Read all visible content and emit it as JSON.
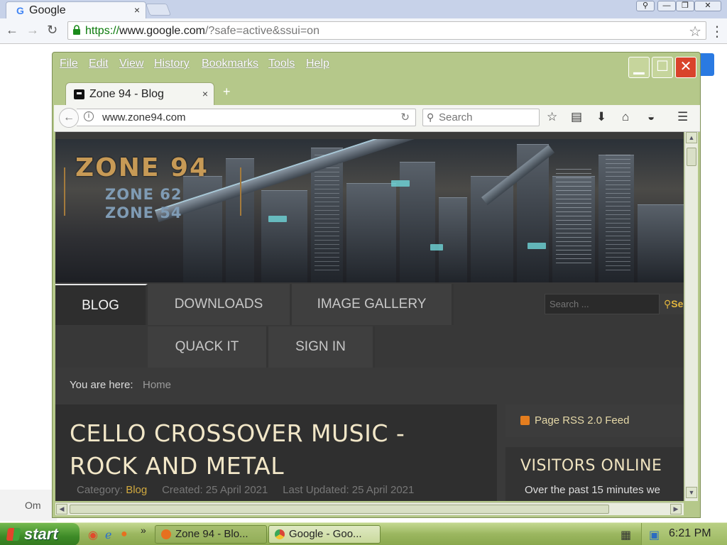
{
  "chrome": {
    "tab_title": "Google",
    "tab_close": "×",
    "url_scheme": "https://",
    "url_host": "www.google.com",
    "url_path": "/?safe=active&ssui=on",
    "window_buttons": [
      "⚲",
      "—",
      "❐",
      "✕"
    ]
  },
  "google_page": {
    "footer_fragment": "Om"
  },
  "firefox": {
    "menu": [
      "File",
      "Edit",
      "View",
      "History",
      "Bookmarks",
      "Tools",
      "Help"
    ],
    "tab_title": "Zone 94 - Blog",
    "tab_close": "×",
    "new_tab": "+",
    "url": "www.zone94.com",
    "search_placeholder": "Search"
  },
  "site": {
    "logo_main": "ZONE 94",
    "logo_sub1": "ZONE 62",
    "logo_sub2": "ZONE 54",
    "nav": {
      "blog": "BLOG",
      "downloads": "DOWNLOADS",
      "gallery": "IMAGE GALLERY",
      "quack": "QUACK IT",
      "signin": "SIGN IN"
    },
    "search_placeholder": "Search ...",
    "search_button": "Se",
    "breadcrumb_label": "You are here:",
    "breadcrumb_home": "Home",
    "article": {
      "title": "CELLO CROSSOVER MUSIC - ROCK AND METAL",
      "category_label": "Category:",
      "category": "Blog",
      "created": "Created: 25 April 2021",
      "updated": "Last Updated: 25 April 2021"
    },
    "sidebar": {
      "rss": "Page RSS 2.0 Feed",
      "visitors_heading": "VISITORS ONLINE",
      "visitors_text": "Over the past 15 minutes we"
    }
  },
  "taskbar": {
    "start": "start",
    "tasks": [
      "Zone 94 - Blo...",
      "Google - Goo..."
    ],
    "quick_more": "»",
    "clock": "6:21 PM"
  }
}
